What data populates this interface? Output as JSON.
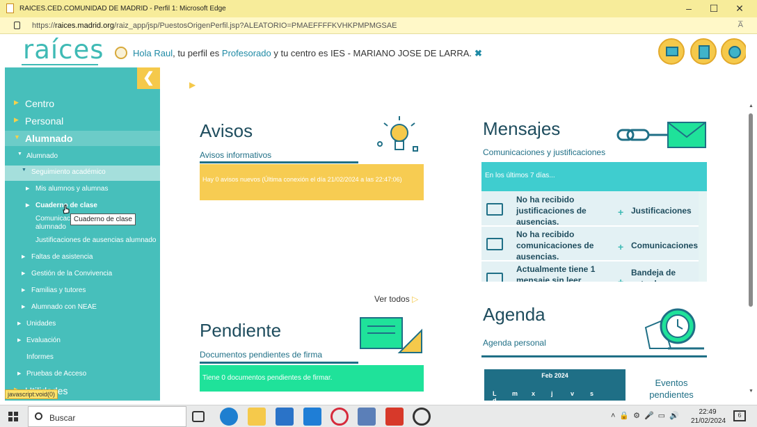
{
  "window": {
    "title": "RAICES.CED.COMUNIDAD DE MADRID - Perfil 1: Microsoft Edge"
  },
  "address": {
    "url_prefix": "https://",
    "url_domain": "raices.madrid.org",
    "url_path": "/raiz_app/jsp/PuestosOrigenPerfil.jsp?ALEATORIO=PMAEFFFFKVHKPMPMGSAE",
    "read_aloud": "A̅"
  },
  "header": {
    "logo": "raíces",
    "greeting": "Hola Raul",
    "profile_prefix": ", tu perfil es ",
    "profile": "Profesorado",
    "center_prefix": " y tu centro es ",
    "center": "IES - MARIANO JOSE DE LARRA.",
    "close": "✖"
  },
  "sidebar": {
    "collapse": "❮",
    "items": [
      {
        "label": "Centro"
      },
      {
        "label": "Personal"
      },
      {
        "label": "Alumnado"
      },
      {
        "label": "Alumnado"
      },
      {
        "label": "Seguimiento académico"
      },
      {
        "label": "Mis alumnos y alumnas"
      },
      {
        "label": "Cuaderno de clase"
      },
      {
        "label": "Comunicaciones alumnado"
      },
      {
        "label": "Justificaciones de ausencias alumnado"
      },
      {
        "label": "Faltas de asistencia"
      },
      {
        "label": "Gestión de la Convivencia"
      },
      {
        "label": "Familias y tutores"
      },
      {
        "label": "Alumnado con NEAE"
      },
      {
        "label": "Unidades"
      },
      {
        "label": "Evaluación"
      },
      {
        "label": "Informes"
      },
      {
        "label": "Pruebas de Acceso"
      },
      {
        "label": "Utilidades"
      }
    ],
    "tooltip": "Cuaderno de clase",
    "status": "javascript:void(0)"
  },
  "avisos": {
    "title": "Avisos",
    "subtitle": "Avisos informativos",
    "message": "Hay 0 avisos nuevos (Última conexión el día 21/02/2024 a las 22:47:06)",
    "ver_todos": "Ver todos"
  },
  "mensajes": {
    "title": "Mensajes",
    "subtitle": "Comunicaciones y justificaciones",
    "header": "En los últimos 7 días...",
    "rows": [
      {
        "text": "No ha recibido justificaciones de ausencias.",
        "action": "Justificaciones"
      },
      {
        "text": "No ha recibido comunicaciones de ausencias.",
        "action": "Comunicaciones"
      },
      {
        "text": "Actualmente tiene 1 mensaje sin leer",
        "action": "Bandeja de entrada"
      }
    ]
  },
  "pendiente": {
    "title": "Pendiente",
    "subtitle": "Documentos pendientes de firma",
    "message": "Tiene 0 documentos pendientes de firmar."
  },
  "agenda": {
    "title": "Agenda",
    "subtitle": "Agenda personal",
    "month": "Feb 2024",
    "weekdays": [
      "L",
      "m",
      "x",
      "j",
      "v",
      "s",
      "d"
    ],
    "eventos": "Eventos pendientes"
  },
  "taskbar": {
    "search": "Buscar",
    "time": "22:49",
    "date": "21/02/2024",
    "notifications": "6"
  },
  "colors": {
    "teal": "#47bfbb",
    "yellow": "#f5c94b",
    "dark_teal": "#1f6f86",
    "green": "#1fe29a"
  }
}
